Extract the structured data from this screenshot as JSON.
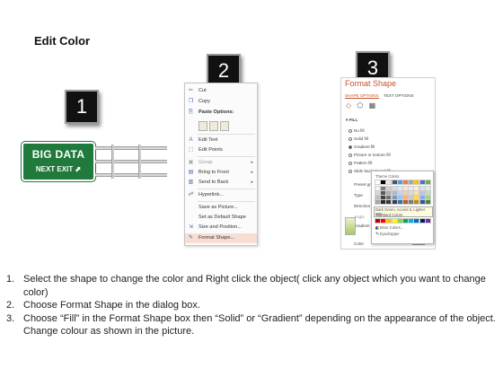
{
  "title": "Edit Color",
  "steps": {
    "one": "1",
    "two": "2",
    "three": "3"
  },
  "sign": {
    "line1": "BIG DATA",
    "line2": "NEXT EXIT"
  },
  "context_menu": {
    "items": [
      {
        "icon": "cut-icon",
        "label": "Cut",
        "arrow": false,
        "dim": false
      },
      {
        "icon": "copy-icon",
        "label": "Copy",
        "arrow": false,
        "dim": false
      },
      {
        "icon": "paste-icon",
        "label": "Paste Options:",
        "arrow": false,
        "dim": false
      },
      {
        "icon": "edit-text-icon",
        "label": "Edit Text",
        "arrow": false,
        "dim": false
      },
      {
        "icon": "edit-points-icon",
        "label": "Edit Points",
        "arrow": false,
        "dim": false
      },
      {
        "icon": "group-icon",
        "label": "Group",
        "arrow": true,
        "dim": true
      },
      {
        "icon": "bring-front-icon",
        "label": "Bring to Front",
        "arrow": true,
        "dim": false
      },
      {
        "icon": "send-back-icon",
        "label": "Send to Back",
        "arrow": true,
        "dim": false
      },
      {
        "icon": "hyperlink-icon",
        "label": "Hyperlink...",
        "arrow": false,
        "dim": false
      },
      {
        "icon": "",
        "label": "Save as Picture...",
        "arrow": false,
        "dim": false
      },
      {
        "icon": "",
        "label": "Set as Default Shape",
        "arrow": false,
        "dim": false
      },
      {
        "icon": "size-position-icon",
        "label": "Size and Position...",
        "arrow": false,
        "dim": false
      },
      {
        "icon": "format-shape-icon",
        "label": "Format Shape...",
        "arrow": false,
        "dim": false
      }
    ]
  },
  "format_pane": {
    "title": "Format Shape",
    "tabs": [
      "SHAPE OPTIONS",
      "TEXT OPTIONS"
    ],
    "section": "FILL",
    "options": [
      "No fill",
      "Solid fill",
      "Gradient fill",
      "Picture or texture fill",
      "Pattern fill",
      "Slide background fill"
    ],
    "selected_option": "Gradient fill",
    "props": [
      "Preset gradients",
      "Type",
      "Direction",
      "Angle",
      "Gradient stops"
    ],
    "color_label": "Color",
    "palette": {
      "theme_label": "Theme Colors",
      "tooltip": "Dark Green, Accent 6, Lighter 80%",
      "standard_label": "Standard Colors",
      "more_colors": "More Colors...",
      "eyedropper": "Eyedropper",
      "theme_row": [
        "#ffffff",
        "#000000",
        "#e7e6e6",
        "#44546a",
        "#5b9bd5",
        "#ed7d31",
        "#a5a5a5",
        "#ffc000",
        "#4472c4",
        "#70ad47"
      ],
      "tint_rows": [
        [
          "#f2f2f2",
          "#7f7f7f",
          "#d0cece",
          "#d6dce4",
          "#deebf6",
          "#fbe5d5",
          "#ededed",
          "#fff2cc",
          "#dae3f3",
          "#e2efd9"
        ],
        [
          "#d8d8d8",
          "#595959",
          "#aeabab",
          "#adb9ca",
          "#bdd7ee",
          "#f7cbac",
          "#dbdbdb",
          "#fee599",
          "#b4c6e7",
          "#c5e0b3"
        ],
        [
          "#bfbfbf",
          "#3f3f3f",
          "#757070",
          "#8496b0",
          "#9dc3e6",
          "#f4b183",
          "#c9c9c9",
          "#ffd965",
          "#8eaadb",
          "#a8d08d"
        ],
        [
          "#a5a5a5",
          "#262626",
          "#3a3838",
          "#323f4f",
          "#2e75b5",
          "#c55a11",
          "#7b7b7b",
          "#bf9000",
          "#2f5496",
          "#538135"
        ]
      ],
      "standard_row": [
        "#c00000",
        "#ff0000",
        "#ffc000",
        "#ffff00",
        "#92d050",
        "#00b050",
        "#00b0f0",
        "#0070c0",
        "#002060",
        "#7030a0"
      ]
    }
  },
  "instructions": [
    {
      "n": "1.",
      "text": "Select the shape to change the color and Right click the object( click any object which you want to change color)"
    },
    {
      "n": "2.",
      "text": "Choose Format Shape in the dialog box."
    },
    {
      "n": "3.",
      "text": "Choose “Fill” in the Format Shape box then “Solid” or “Gradient” depending on the appearance of the object. Change colour as shown in the picture."
    }
  ]
}
